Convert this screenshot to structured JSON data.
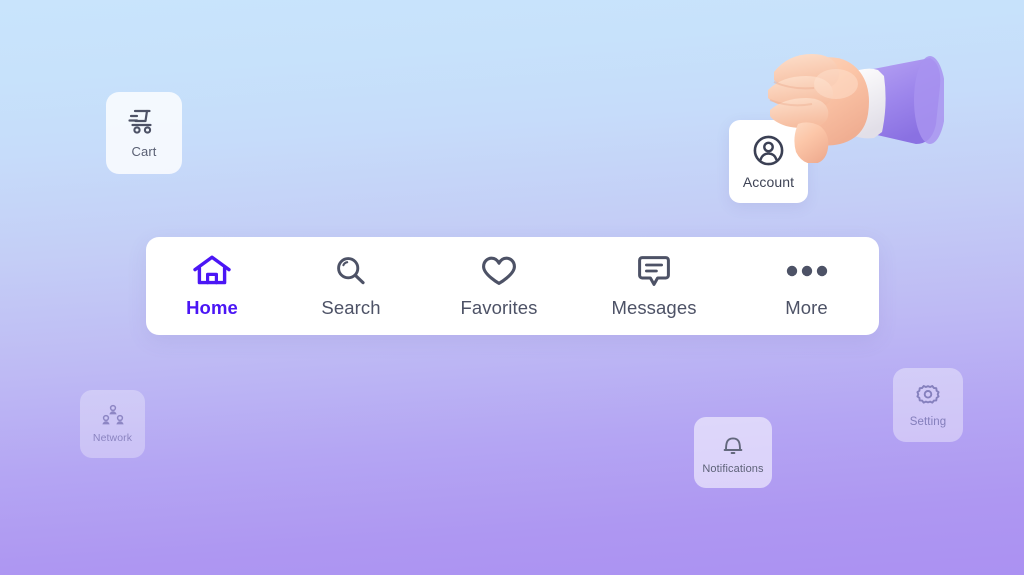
{
  "theme": {
    "background_top": "#c9e4fc",
    "background_bottom": "#ab91f2",
    "accent": "#4b16f5",
    "icon_default": "#4d5266",
    "card_surface": "#ffffff"
  },
  "nav_bar": {
    "items": [
      {
        "id": "home",
        "label": "Home",
        "icon": "home-icon",
        "active": true
      },
      {
        "id": "search",
        "label": "Search",
        "icon": "search-icon",
        "active": false
      },
      {
        "id": "favorites",
        "label": "Favorites",
        "icon": "heart-icon",
        "active": false
      },
      {
        "id": "messages",
        "label": "Messages",
        "icon": "chat-bubble-icon",
        "active": false
      },
      {
        "id": "more",
        "label": "More",
        "icon": "ellipsis-icon",
        "active": false
      }
    ]
  },
  "floating_cards": [
    {
      "id": "cart",
      "label": "Cart",
      "icon": "shopping-cart-icon"
    },
    {
      "id": "account",
      "label": "Account",
      "icon": "user-circle-icon"
    },
    {
      "id": "network",
      "label": "Network",
      "icon": "network-users-icon"
    },
    {
      "id": "notifications",
      "label": "Notifications",
      "icon": "bell-icon"
    },
    {
      "id": "setting",
      "label": "Setting",
      "icon": "gear-icon"
    }
  ],
  "cursor": {
    "type": "hand-3d-cursor",
    "gesture": "pinch-grab",
    "skin_color": "#fbc6a8",
    "cuff_color": "#f4f2f6",
    "sleeve_color": "#9b84e8",
    "target": "Account"
  }
}
